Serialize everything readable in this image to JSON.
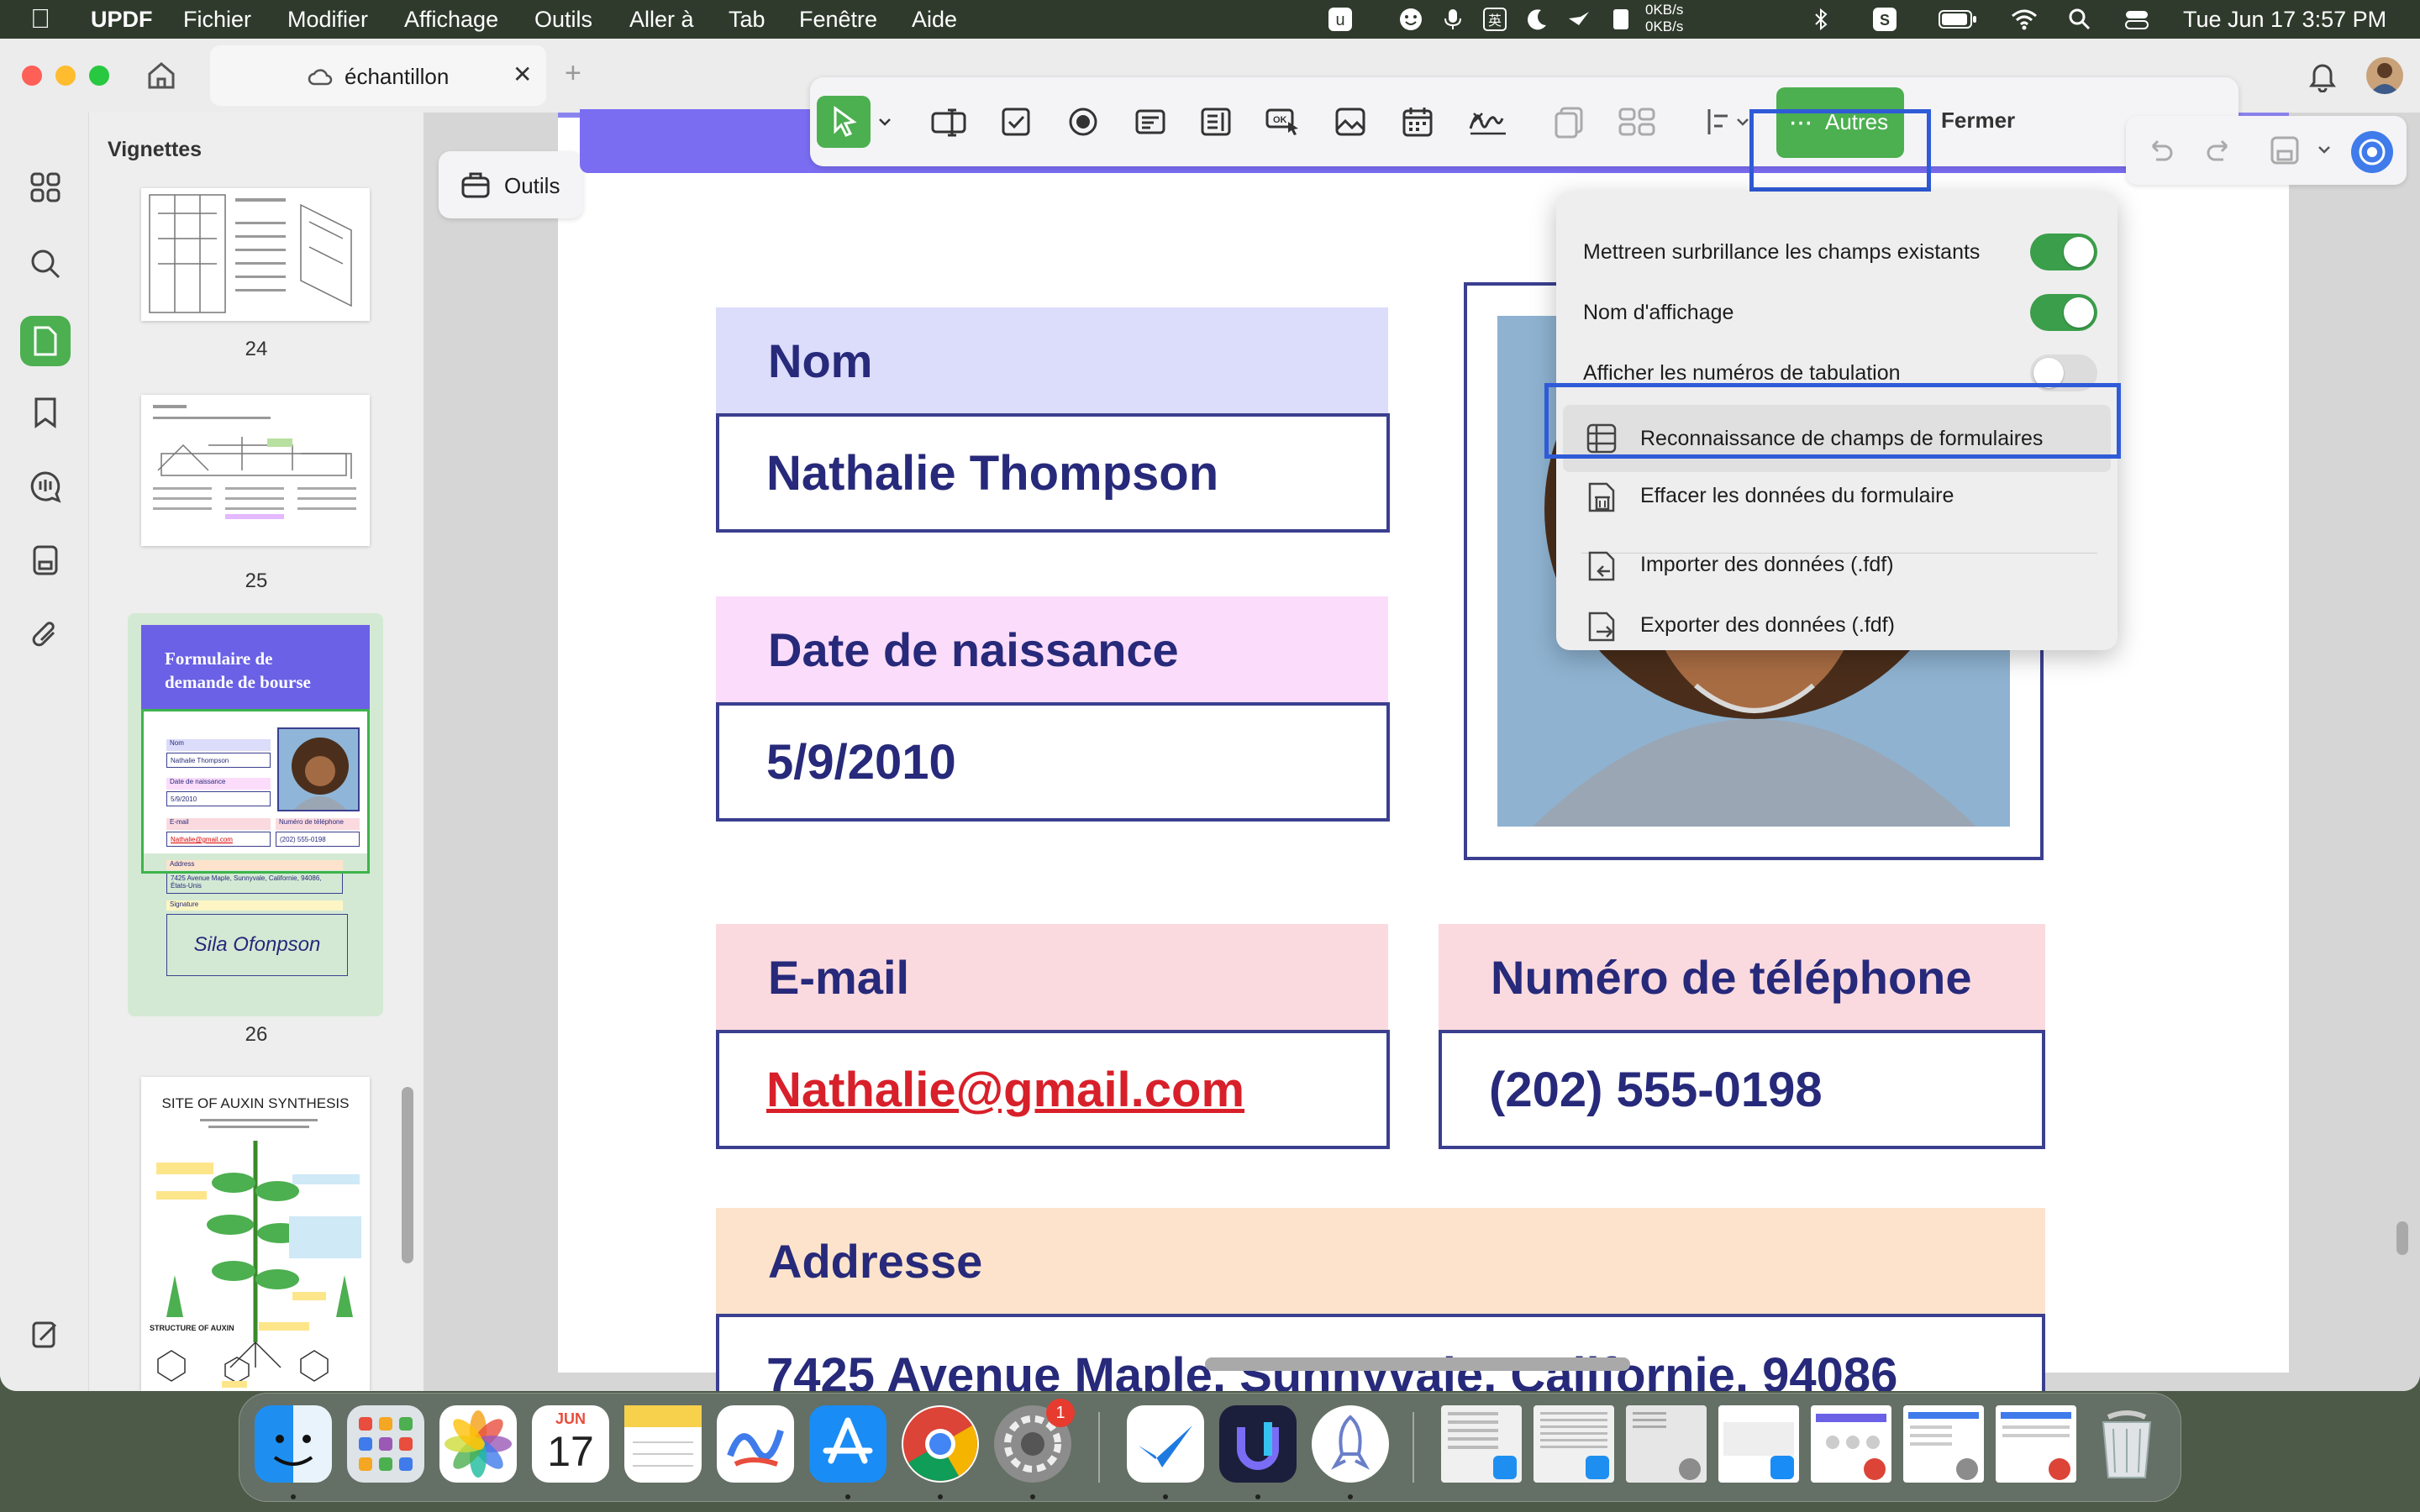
{
  "menubar": {
    "app": "UPDF",
    "items": [
      "Fichier",
      "Modifier",
      "Affichage",
      "Outils",
      "Aller à",
      "Tab",
      "Fenêtre",
      "Aide"
    ],
    "network": [
      "0KB/s",
      "0KB/s"
    ],
    "datetime": "Tue Jun 17  3:57 PM"
  },
  "tab": {
    "title": "échantillon"
  },
  "sidebar": {
    "title": "Vignettes",
    "pages": [
      "24",
      "25",
      "26"
    ],
    "thumb26": {
      "title": "Formulaire de demande de bourse",
      "name_label": "Nom",
      "name": "Nathalie Thompson",
      "dob_label": "Date de naissance",
      "dob": "5/9/2010",
      "email_label": "E-mail",
      "email": "Nathalie@gmail.com",
      "phone_label": "Numéro de téléphone",
      "phone": "(202) 555-0198",
      "address_label": "Address",
      "address": "7425 Avenue Maple, Sunnyvale, Californie, 94086, États-Unis",
      "signature_label": "Signature",
      "signature": "Sila Ofonpson"
    },
    "thumb27": {
      "title": "SITE OF AUXIN SYNTHESIS",
      "subtitle": "STRUCTURE OF AUXIN"
    }
  },
  "toolbar": {
    "tools_label": "Outils",
    "others_label": "Autres",
    "close_label": "Fermer"
  },
  "menu": {
    "toggles": [
      {
        "label": "Mettreen surbrillance les champs existants",
        "on": true
      },
      {
        "label": "Nom d'affichage",
        "on": true
      },
      {
        "label": "Afficher les numéros de tabulation",
        "on": false
      }
    ],
    "actions": [
      "Reconnaissance de champs de formulaires",
      "Effacer les données du formulaire",
      "Importer des données (.fdf)",
      "Exporter des données (.fdf)"
    ]
  },
  "form": {
    "name_label": "Nom",
    "name": "Nathalie Thompson",
    "dob_label": "Date de naissance",
    "dob": "5/9/2010",
    "email_label": "E-mail",
    "email": "Nathalie@gmail.com",
    "phone_label": "Numéro de téléphone",
    "phone": "(202) 555-0198",
    "address_label": "Addresse",
    "address": "7425 Avenue Maple, Sunnyvale, Californie, 94086"
  },
  "dock": {
    "calendar_month": "JUN",
    "calendar_day": "17",
    "settings_badge": "1"
  },
  "colors": {
    "accent": "#5cb85c",
    "highlight": "#2f5bd8",
    "label_lavender": "#dcdcfb",
    "label_pink": "#fbdcfa",
    "label_rose": "#fadadf",
    "label_peach": "#fde3cc",
    "field_border": "#3b3f8f",
    "text_navy": "#27297a"
  }
}
